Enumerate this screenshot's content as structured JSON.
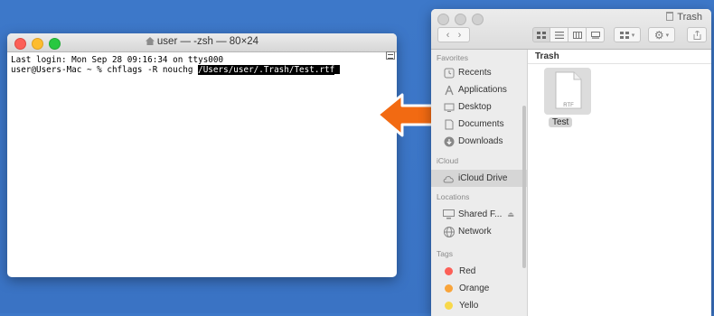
{
  "terminal": {
    "title": "user — -zsh — 80×24",
    "line1": "Last login: Mon Sep 28 09:16:34 on ttys000",
    "prompt": "user@Users-Mac ~ % chflags -R nouchg ",
    "path_arg": "/Users/user/.Trash/Test.rtf"
  },
  "finder": {
    "title": "Trash",
    "path_label": "Trash",
    "sidebar": {
      "favorites_label": "Favorites",
      "favorites": [
        {
          "label": "Recents",
          "icon": "clock-icon"
        },
        {
          "label": "Applications",
          "icon": "applications-icon"
        },
        {
          "label": "Desktop",
          "icon": "desktop-icon"
        },
        {
          "label": "Documents",
          "icon": "documents-icon"
        },
        {
          "label": "Downloads",
          "icon": "downloads-icon"
        }
      ],
      "icloud_label": "iCloud",
      "icloud_drive": "iCloud Drive",
      "locations_label": "Locations",
      "shared": "Shared F...",
      "network": "Network",
      "tags_label": "Tags",
      "tags": [
        {
          "label": "Red",
          "color": "#fc5f57"
        },
        {
          "label": "Orange",
          "color": "#f9a43a"
        },
        {
          "label": "Yello",
          "color": "#f8d84a"
        }
      ]
    },
    "file": {
      "name": "Test",
      "type_label": "RTF"
    }
  },
  "colors": {
    "arrow": "#f26a12",
    "desktop": "#3d78c9"
  }
}
